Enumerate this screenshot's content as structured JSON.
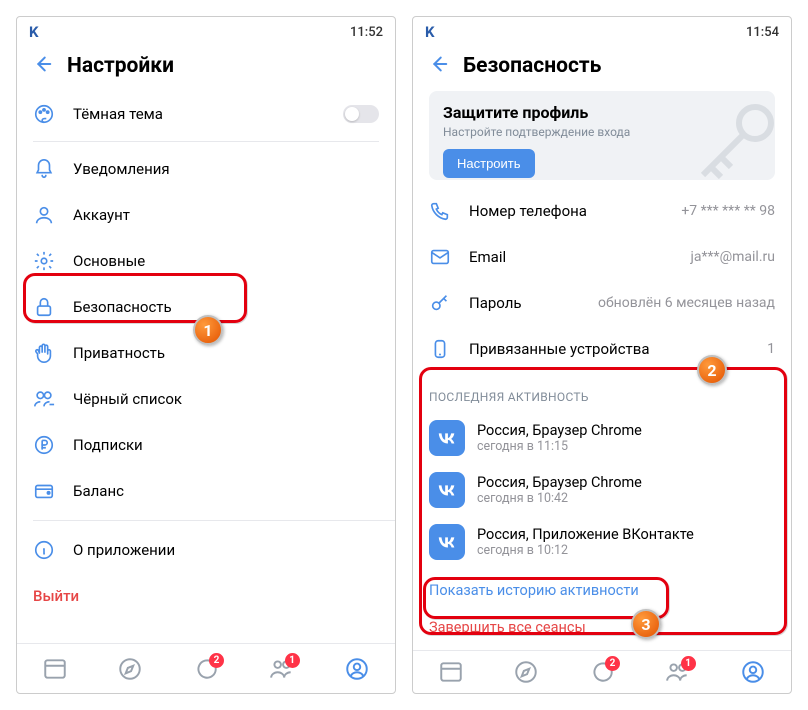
{
  "left": {
    "status": {
      "carrier": "K",
      "time": "11:52"
    },
    "title": "Настройки",
    "dark_theme": "Тёмная тема",
    "items": [
      {
        "label": "Уведомления"
      },
      {
        "label": "Аккаунт"
      },
      {
        "label": "Основные"
      },
      {
        "label": "Безопасность"
      },
      {
        "label": "Приватность"
      },
      {
        "label": "Чёрный список"
      },
      {
        "label": "Подписки"
      },
      {
        "label": "Баланс"
      }
    ],
    "about": "О приложении",
    "logout": "Выйти"
  },
  "right": {
    "status": {
      "carrier": "K",
      "time": "11:54"
    },
    "title": "Безопасность",
    "promo": {
      "heading": "Защитите профиль",
      "sub": "Настройте подтверждение входа",
      "button": "Настроить"
    },
    "fields": {
      "phone": {
        "label": "Номер телефона",
        "value": "+7 *** *** ** 98"
      },
      "email": {
        "label": "Email",
        "value": "ja***@mail.ru"
      },
      "password": {
        "label": "Пароль",
        "value": "обновлён 6 месяцев назад"
      },
      "devices": {
        "label": "Привязанные устройства",
        "value": "1"
      }
    },
    "activity_title": "ПОСЛЕДНЯЯ АКТИВНОСТЬ",
    "sessions": [
      {
        "title": "Россия, Браузер Chrome",
        "sub": "сегодня в 11:15"
      },
      {
        "title": "Россия, Браузер Chrome",
        "sub": "сегодня в 10:42"
      },
      {
        "title": "Россия, Приложение ВКонтакте",
        "sub": "сегодня в 10:12"
      }
    ],
    "show_history": "Показать историю активности",
    "end_sessions": "Завершить все сеансы"
  },
  "nav": {
    "news_badge": "",
    "chat_badge": "2",
    "friends_badge": "1"
  },
  "callouts": {
    "one": "1",
    "two": "2",
    "three": "3"
  }
}
